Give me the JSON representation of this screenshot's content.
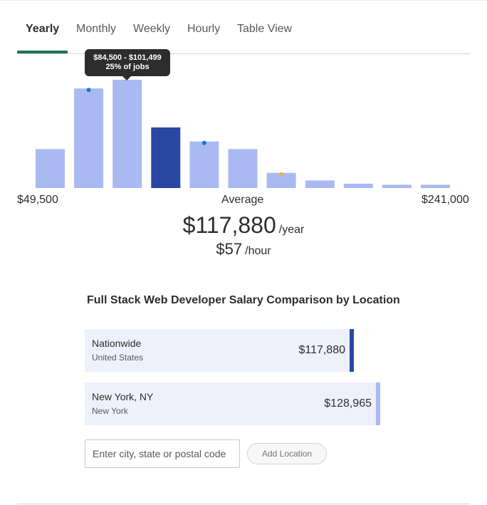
{
  "tabs": [
    {
      "label": "Yearly",
      "active": true
    },
    {
      "label": "Monthly",
      "active": false
    },
    {
      "label": "Weekly",
      "active": false
    },
    {
      "label": "Hourly",
      "active": false
    },
    {
      "label": "Table View",
      "active": false
    }
  ],
  "tooltip": {
    "range": "$84,500 - $101,499",
    "share": "25% of jobs"
  },
  "chart_data": {
    "type": "bar",
    "min_label": "$49,500",
    "max_label": "$241,000",
    "average_label": "Average",
    "values": [
      36,
      92,
      100,
      56,
      43,
      36,
      14,
      7,
      4,
      3,
      3
    ],
    "highlighted_index": 3,
    "colors": {
      "bar": "#a9baf2",
      "highlight": "#2a47a3",
      "dot_blue": "#1a73e8",
      "dot_orange": "#f6a94c"
    },
    "dots": [
      {
        "bar": 1,
        "color": "blue"
      },
      {
        "bar": 4,
        "color": "blue"
      },
      {
        "bar": 6,
        "color": "orange"
      }
    ]
  },
  "salary": {
    "yearly_value": "$117,880",
    "yearly_unit": "/year",
    "hourly_value": "$57",
    "hourly_unit": "/hour"
  },
  "comparison": {
    "title": "Full Stack Web Developer Salary Comparison by Location",
    "rows": [
      {
        "name": "Nationwide",
        "sub": "United States",
        "value": "$117,880",
        "accent": "#2a47a3"
      },
      {
        "name": "New York, NY",
        "sub": "New York",
        "value": "$128,965",
        "accent": "#a9baf2"
      }
    ],
    "input_placeholder": "Enter city, state or postal code",
    "add_button": "Add Location"
  }
}
